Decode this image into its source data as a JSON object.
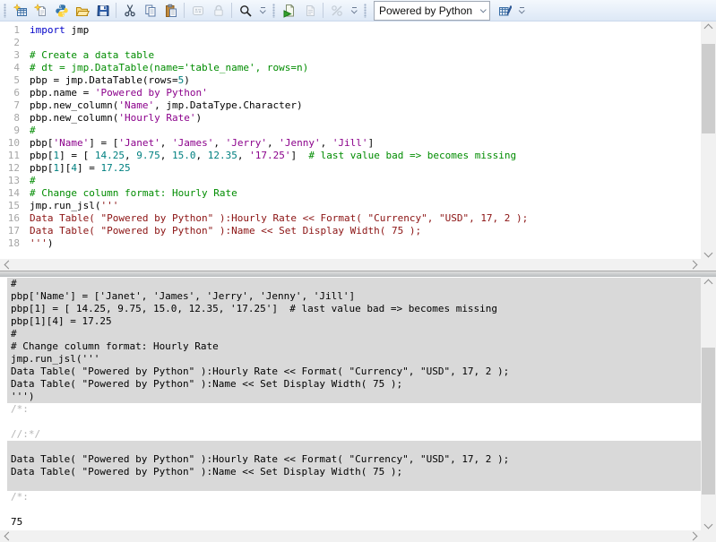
{
  "colors": {
    "keyword": "#0000c8",
    "comment": "#008c00",
    "string": "#8b008b",
    "number": "#008080",
    "jsl_string": "#8b1212",
    "muted_marker": "#b5b5b5",
    "log_block_bg": "#d9d9d9",
    "toolbar_bg": "#dde8f6"
  },
  "toolbar": {
    "groups": [
      {
        "items": [
          {
            "type": "btn",
            "icon": "new-data-table-icon"
          },
          {
            "type": "btn",
            "icon": "new-script-icon"
          },
          {
            "type": "btn",
            "icon": "python-icon"
          },
          {
            "type": "btn",
            "icon": "open-icon"
          },
          {
            "type": "btn",
            "icon": "save-icon"
          },
          {
            "type": "sep"
          },
          {
            "type": "btn",
            "icon": "cut-icon"
          },
          {
            "type": "btn",
            "icon": "copy-icon"
          },
          {
            "type": "btn",
            "icon": "paste-icon"
          },
          {
            "type": "sep"
          },
          {
            "type": "btn",
            "icon": "properties-icon",
            "disabled": true
          },
          {
            "type": "btn",
            "icon": "lock-icon",
            "disabled": true
          },
          {
            "type": "sep"
          },
          {
            "type": "btn",
            "icon": "search-icon"
          },
          {
            "type": "overflow"
          }
        ]
      },
      {
        "items": [
          {
            "type": "btn",
            "icon": "run-script-icon"
          },
          {
            "type": "btn",
            "icon": "edit-script-icon",
            "disabled": true
          },
          {
            "type": "sep"
          },
          {
            "type": "btn",
            "icon": "debug-script-icon",
            "disabled": true
          },
          {
            "type": "overflow"
          }
        ]
      },
      {
        "items": [
          {
            "type": "combo",
            "value": "Powered by Python"
          },
          {
            "type": "btn",
            "icon": "make-data-table-icon"
          },
          {
            "type": "overflow"
          }
        ]
      }
    ]
  },
  "editor": {
    "lines": [
      {
        "n": "1",
        "segs": [
          [
            "keyword",
            "import"
          ],
          [
            "plain",
            " jmp"
          ]
        ]
      },
      {
        "n": "2",
        "segs": []
      },
      {
        "n": "3",
        "segs": [
          [
            "comment",
            "# Create a data table"
          ]
        ]
      },
      {
        "n": "4",
        "segs": [
          [
            "comment",
            "# dt = jmp.DataTable(name='table_name', rows=n)"
          ]
        ]
      },
      {
        "n": "5",
        "segs": [
          [
            "plain",
            "pbp = jmp.DataTable(rows="
          ],
          [
            "number",
            "5"
          ],
          [
            "plain",
            ")"
          ]
        ]
      },
      {
        "n": "6",
        "segs": [
          [
            "plain",
            "pbp.name = "
          ],
          [
            "string",
            "'Powered by Python'"
          ]
        ]
      },
      {
        "n": "7",
        "segs": [
          [
            "plain",
            "pbp.new_column("
          ],
          [
            "string",
            "'Name'"
          ],
          [
            "plain",
            ", jmp.DataType.Character)"
          ]
        ]
      },
      {
        "n": "8",
        "segs": [
          [
            "plain",
            "pbp.new_column("
          ],
          [
            "string",
            "'Hourly Rate'"
          ],
          [
            "plain",
            ")"
          ]
        ]
      },
      {
        "n": "9",
        "segs": [
          [
            "comment",
            "#"
          ]
        ]
      },
      {
        "n": "10",
        "segs": [
          [
            "plain",
            "pbp["
          ],
          [
            "string",
            "'Name'"
          ],
          [
            "plain",
            "] = ["
          ],
          [
            "string",
            "'Janet'"
          ],
          [
            "plain",
            ", "
          ],
          [
            "string",
            "'James'"
          ],
          [
            "plain",
            ", "
          ],
          [
            "string",
            "'Jerry'"
          ],
          [
            "plain",
            ", "
          ],
          [
            "string",
            "'Jenny'"
          ],
          [
            "plain",
            ", "
          ],
          [
            "string",
            "'Jill'"
          ],
          [
            "plain",
            "]"
          ]
        ]
      },
      {
        "n": "11",
        "segs": [
          [
            "plain",
            "pbp["
          ],
          [
            "number",
            "1"
          ],
          [
            "plain",
            "] = [ "
          ],
          [
            "number",
            "14.25"
          ],
          [
            "plain",
            ", "
          ],
          [
            "number",
            "9.75"
          ],
          [
            "plain",
            ", "
          ],
          [
            "number",
            "15.0"
          ],
          [
            "plain",
            ", "
          ],
          [
            "number",
            "12.35"
          ],
          [
            "plain",
            ", "
          ],
          [
            "string",
            "'17.25'"
          ],
          [
            "plain",
            "]  "
          ],
          [
            "comment",
            "# last value bad => becomes missing"
          ]
        ]
      },
      {
        "n": "12",
        "segs": [
          [
            "plain",
            "pbp["
          ],
          [
            "number",
            "1"
          ],
          [
            "plain",
            "]["
          ],
          [
            "number",
            "4"
          ],
          [
            "plain",
            "] = "
          ],
          [
            "number",
            "17.25"
          ]
        ]
      },
      {
        "n": "13",
        "segs": [
          [
            "comment",
            "#"
          ]
        ]
      },
      {
        "n": "14",
        "segs": [
          [
            "comment",
            "# Change column format: Hourly Rate"
          ]
        ]
      },
      {
        "n": "15",
        "segs": [
          [
            "plain",
            "jmp.run_jsl("
          ],
          [
            "jsl",
            "'''"
          ]
        ]
      },
      {
        "n": "16",
        "segs": [
          [
            "jsl",
            "Data Table( \"Powered by Python\" ):Hourly Rate << Format( \"Currency\", \"USD\", 17, 2 );"
          ]
        ]
      },
      {
        "n": "17",
        "segs": [
          [
            "jsl",
            "Data Table( \"Powered by Python\" ):Name << Set Display Width( 75 );"
          ]
        ]
      },
      {
        "n": "18",
        "segs": [
          [
            "jsl",
            "'''"
          ],
          [
            "plain",
            ")"
          ]
        ]
      }
    ]
  },
  "log": {
    "blocks": [
      {
        "bg": "gray",
        "lines": [
          {
            "text": "#"
          },
          {
            "text": "pbp['Name'] = ['Janet', 'James', 'Jerry', 'Jenny', 'Jill']"
          },
          {
            "text": "pbp[1] = [ 14.25, 9.75, 15.0, 12.35, '17.25']  # last value bad => becomes missing"
          },
          {
            "text": "pbp[1][4] = 17.25"
          },
          {
            "text": "#"
          },
          {
            "text": "# Change column format: Hourly Rate"
          },
          {
            "text": "jmp.run_jsl('''"
          },
          {
            "text": "Data Table( \"Powered by Python\" ):Hourly Rate << Format( \"Currency\", \"USD\", 17, 2 );"
          },
          {
            "text": "Data Table( \"Powered by Python\" ):Name << Set Display Width( 75 );"
          },
          {
            "text": "''')"
          }
        ]
      },
      {
        "bg": "white",
        "lines": [
          {
            "text": "/*:",
            "muted": true
          },
          {
            "text": ""
          },
          {
            "text": "//:*/",
            "muted": true
          }
        ]
      },
      {
        "bg": "gray",
        "lines": [
          {
            "text": ""
          },
          {
            "text": "Data Table( \"Powered by Python\" ):Hourly Rate << Format( \"Currency\", \"USD\", 17, 2 );"
          },
          {
            "text": "Data Table( \"Powered by Python\" ):Name << Set Display Width( 75 );"
          },
          {
            "text": ""
          }
        ]
      },
      {
        "bg": "white",
        "lines": [
          {
            "text": "/*:",
            "muted": true
          },
          {
            "text": ""
          },
          {
            "text": "75"
          }
        ]
      }
    ]
  }
}
